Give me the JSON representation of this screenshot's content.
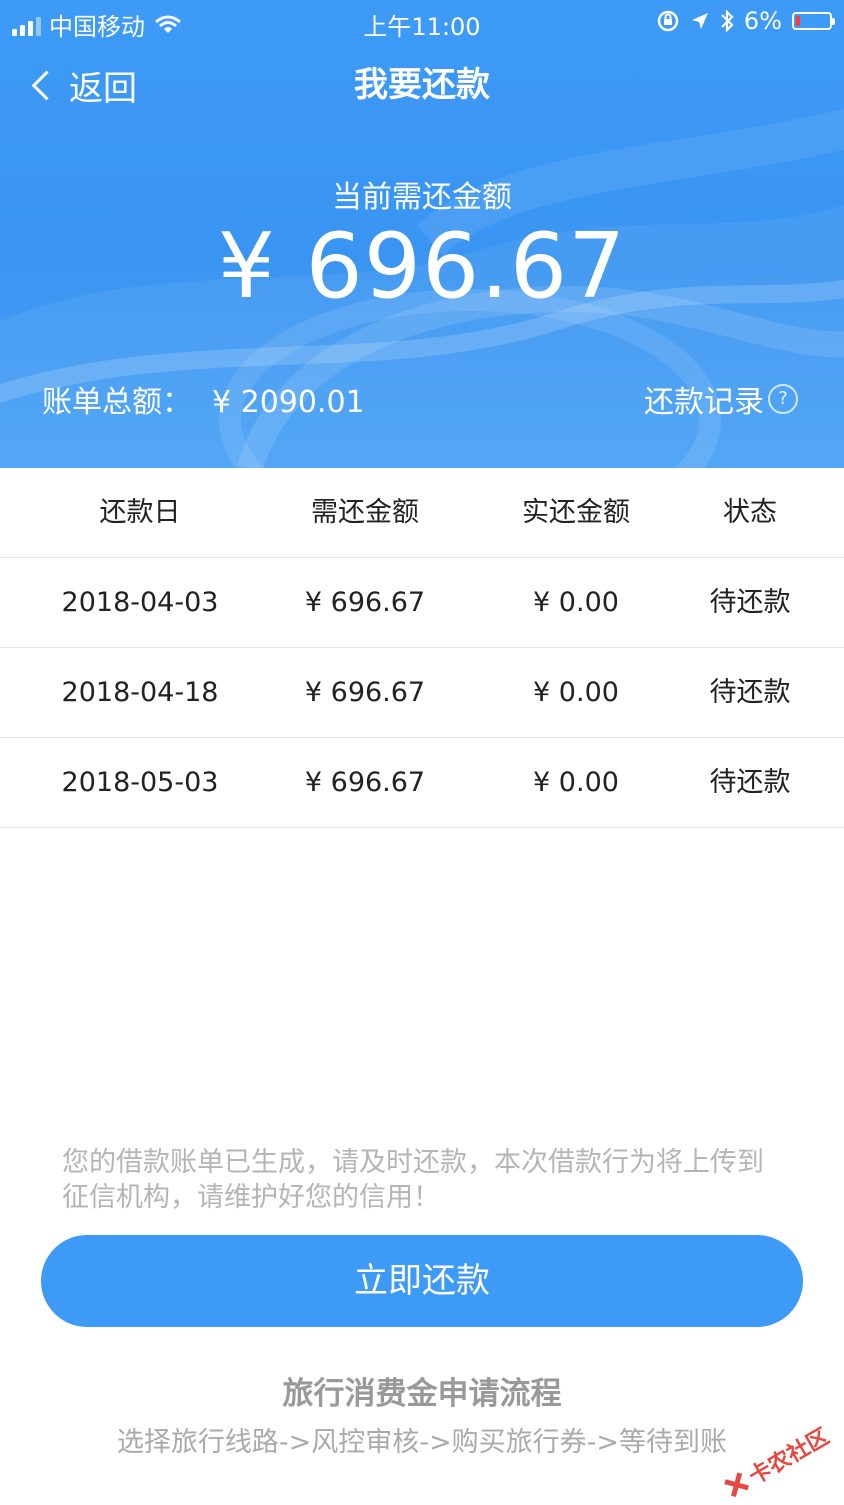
{
  "status_bar": {
    "carrier": "中国移动",
    "time": "上午11:00",
    "battery": "6%",
    "icons": [
      "signal-icon",
      "wifi-icon",
      "rotation-lock-icon",
      "location-icon",
      "bluetooth-icon",
      "battery-icon"
    ]
  },
  "nav": {
    "back_label": "返回",
    "title": "我要还款"
  },
  "summary": {
    "due_label": "当前需还金额",
    "due_amount": "¥ 696.67",
    "total_label": "账单总额：",
    "total_value": "¥ 2090.01",
    "record_label": "还款记录",
    "help_icon_char": "?"
  },
  "table": {
    "headers": [
      "还款日",
      "需还金额",
      "实还金额",
      "状态"
    ],
    "rows": [
      [
        "2018-04-03",
        "¥ 696.67",
        "¥ 0.00",
        "待还款"
      ],
      [
        "2018-04-18",
        "¥ 696.67",
        "¥ 0.00",
        "待还款"
      ],
      [
        "2018-05-03",
        "¥ 696.67",
        "¥ 0.00",
        "待还款"
      ]
    ]
  },
  "notice": "您的借款账单已生成，请及时还款，本次借款行为将上传到征信机构，请维护好您的信用！",
  "pay_button": "立即还款",
  "flow": {
    "title": "旅行消费金申请流程",
    "steps": "选择旅行线路->风控审核->购买旅行券->等待到账"
  },
  "watermark": "卡农社区",
  "colors": {
    "primary": "#3d9af6",
    "notice_text": "#b5b5b5",
    "battery_low": "#ff3b30"
  }
}
